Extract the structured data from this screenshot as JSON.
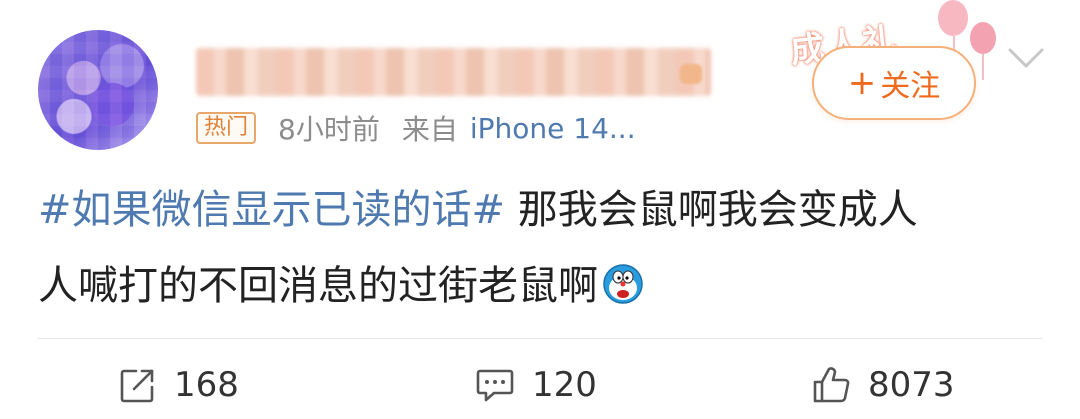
{
  "post": {
    "username": "████████████",
    "badge": "热门",
    "time": "8小时前",
    "from_label": "来自",
    "device": "iPhone 14...",
    "decor_text": "成人礼",
    "follow_plus": "+",
    "follow_label": "关注",
    "topic": "#如果微信显示已读的话#",
    "content_line1": " 那我会鼠啊我会变成人",
    "content_line2": "人喊打的不回消息的过街老鼠啊"
  },
  "actions": {
    "repost_count": "168",
    "comment_count": "120",
    "like_count": "8073"
  },
  "colors": {
    "link": "#4f7ab0",
    "follow": "#f06a1e",
    "hot_badge": "#e0823a",
    "meta_gray": "#8c8c8c"
  },
  "icons": {
    "repost": "repost-icon",
    "comment": "comment-icon",
    "like": "thumbs-up-icon",
    "chevron": "chevron-down-icon",
    "emoji": "doraemon-emoji-icon"
  }
}
